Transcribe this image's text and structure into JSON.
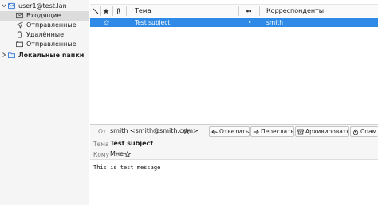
{
  "folders": {
    "account": "user1@test.lan",
    "items": [
      {
        "label": "Входящие",
        "icon": "inbox-icon"
      },
      {
        "label": "Отправленные",
        "icon": "outbox-icon"
      },
      {
        "label": "Удалённые",
        "icon": "trash-icon"
      },
      {
        "label": "Отправленные",
        "icon": "sent-icon"
      }
    ],
    "local": "Локальные папки"
  },
  "thread": {
    "columns": {
      "thread_icon": "thread-icon",
      "star_icon": "star-icon",
      "attachment_icon": "paperclip-icon",
      "subject": "Тема",
      "read_icon": "read-status-icon",
      "correspondents": "Корреспонденты"
    },
    "rows": [
      {
        "subject": "Test subject",
        "read_mark": "•",
        "correspondent": "smith",
        "selected": true
      }
    ]
  },
  "message": {
    "from_label": "От",
    "from_value": "smith <smith@smith.com>",
    "subject_label": "Тема",
    "subject_value": "Test subject",
    "to_label": "Кому",
    "to_value": "Мне",
    "buttons": {
      "reply": "Ответить",
      "forward": "Переслать",
      "archive": "Архивировать",
      "spam": "Спам"
    },
    "body": "This is test message"
  },
  "colors": {
    "selection": "#2e8ae6",
    "accent": "#2e8ae6"
  }
}
